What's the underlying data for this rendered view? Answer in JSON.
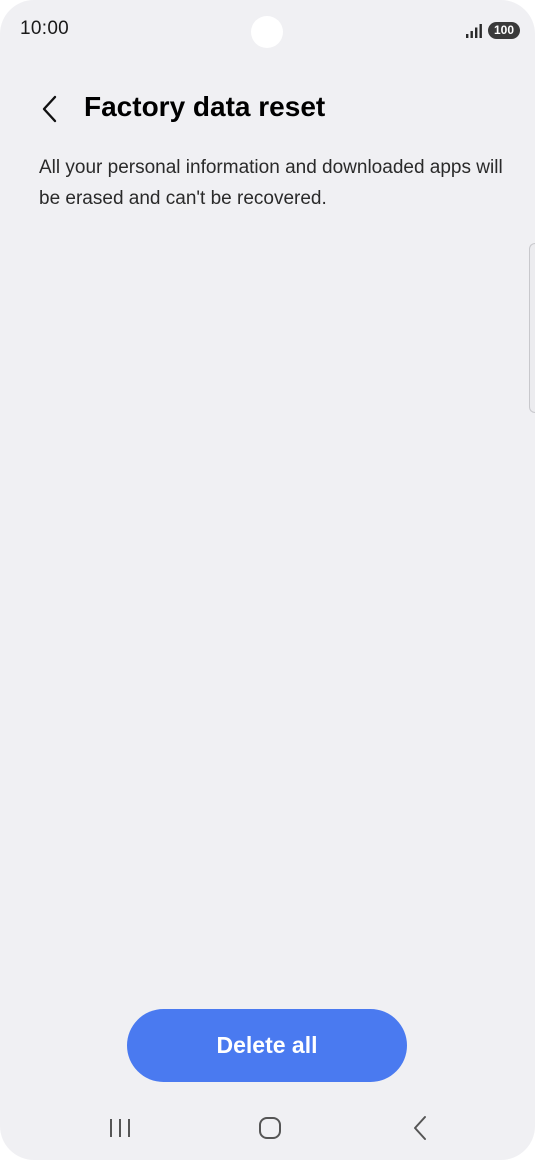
{
  "status_bar": {
    "time": "10:00",
    "battery": "100",
    "icons": [
      "signal-icon",
      "battery-icon"
    ]
  },
  "header": {
    "back_icon": "chevron-left-icon",
    "title": "Factory data reset"
  },
  "content": {
    "description": "All your personal information and downloaded apps will be erased and can't be recovered."
  },
  "actions": {
    "delete_all_label": "Delete all",
    "accent_color": "#4a7af0"
  },
  "nav_bar": {
    "items": [
      "recents-icon",
      "home-icon",
      "back-icon"
    ]
  }
}
